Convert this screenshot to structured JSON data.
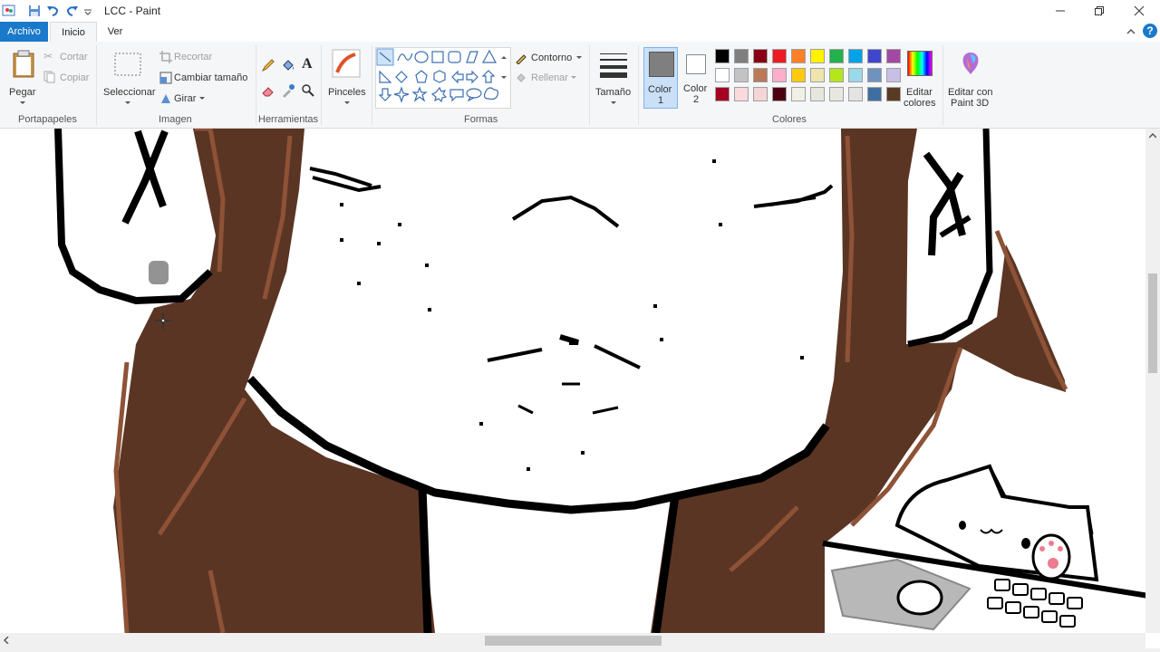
{
  "window": {
    "title": "LCC - Paint",
    "minimize_icon": "minimize-icon",
    "restore_icon": "restore-icon",
    "close_icon": "close-icon"
  },
  "tabs": {
    "archivo": "Archivo",
    "inicio": "Inicio",
    "ver": "Ver"
  },
  "ribbon": {
    "portapapeles": {
      "label": "Portapapeles",
      "pegar": "Pegar",
      "cortar": "Cortar",
      "copiar": "Copiar"
    },
    "imagen": {
      "label": "Imagen",
      "seleccionar": "Seleccionar",
      "recortar": "Recortar",
      "cambiar_tamano": "Cambiar tamaño",
      "girar": "Girar"
    },
    "herramientas": {
      "label": "Herramientas"
    },
    "pinceles": "Pinceles",
    "formas": {
      "label": "Formas",
      "contorno": "Contorno",
      "rellenar": "Rellenar"
    },
    "tamano": "Tamaño",
    "color1": "Color",
    "color1_num": "1",
    "color2": "Color",
    "color2_num": "2",
    "colores_label": "Colores",
    "editar_colores_1": "Editar",
    "editar_colores_2": "colores",
    "editar_paint3d_1": "Editar con",
    "editar_paint3d_2": "Paint 3D"
  },
  "palette": {
    "row1": [
      "#000000",
      "#7f7f7f",
      "#880015",
      "#ed1c24",
      "#ff7f27",
      "#fff200",
      "#22b14c",
      "#00a2e8",
      "#3f48cc",
      "#a349a4"
    ],
    "row2": [
      "#ffffff",
      "#c3c3c3",
      "#b97a57",
      "#ffaec9",
      "#ffc90e",
      "#efe4b0",
      "#b5e61d",
      "#99d9ea",
      "#7092be",
      "#c8bfe7"
    ],
    "row3": [
      "#a50021",
      "#fadadd",
      "#f4d6d6",
      "#4b0010",
      "#f0f0e6",
      "#e6e6dc",
      "#e8e8e0",
      "#e3e3e3",
      "#3f6fa0",
      "#5a3a22"
    ]
  },
  "colors": {
    "accent": "#1979ca",
    "hair": "#5b3524",
    "hair_edge": "#8e5236",
    "color1_value": "#7f7f7f",
    "color2_value": "#ffffff"
  }
}
